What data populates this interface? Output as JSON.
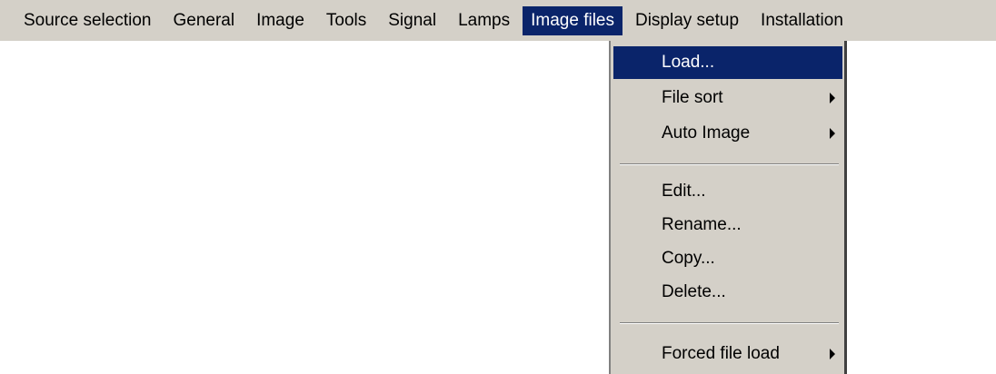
{
  "menubar": {
    "items": [
      {
        "label": "Source selection"
      },
      {
        "label": "General"
      },
      {
        "label": "Image"
      },
      {
        "label": "Tools"
      },
      {
        "label": "Signal"
      },
      {
        "label": "Lamps"
      },
      {
        "label": "Image files"
      },
      {
        "label": "Display setup"
      },
      {
        "label": "Installation"
      }
    ],
    "active_item": "Image files"
  },
  "dropdown": {
    "group1": [
      {
        "label": "Load...",
        "highlighted": true
      },
      {
        "label": "File sort",
        "submenu": true
      },
      {
        "label": "Auto Image",
        "submenu": true
      }
    ],
    "group2": [
      {
        "label": "Edit..."
      },
      {
        "label": "Rename..."
      },
      {
        "label": "Copy..."
      },
      {
        "label": "Delete..."
      }
    ],
    "group3": [
      {
        "label": "Forced file load",
        "submenu": true
      }
    ]
  },
  "colors": {
    "menu_background": "#d4d0c8",
    "highlight": "#0a246a",
    "highlight_text": "#ffffff"
  }
}
